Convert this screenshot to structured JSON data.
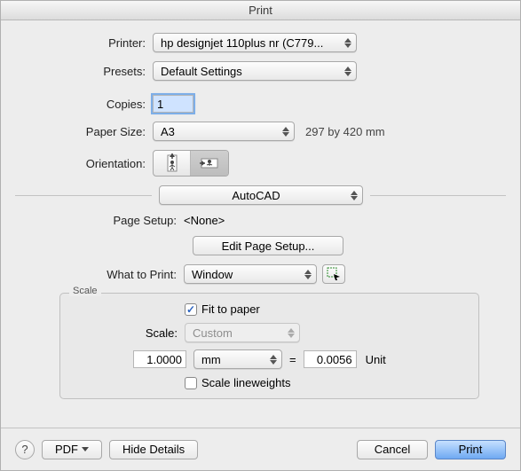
{
  "window": {
    "title": "Print"
  },
  "header": {
    "printer_label": "Printer:",
    "printer_value": "hp designjet 110plus nr (C779...",
    "presets_label": "Presets:",
    "presets_value": "Default Settings"
  },
  "copies": {
    "label": "Copies:",
    "value": "1"
  },
  "paper": {
    "label": "Paper Size:",
    "value": "A3",
    "dims": "297 by 420 mm"
  },
  "orientation": {
    "label": "Orientation:"
  },
  "section": {
    "module": "AutoCAD"
  },
  "page_setup": {
    "label": "Page Setup:",
    "value": "<None>",
    "edit_label": "Edit Page Setup..."
  },
  "what_to_print": {
    "label": "What to Print:",
    "value": "Window"
  },
  "scale": {
    "legend": "Scale",
    "fit_label": "Fit to paper",
    "fit_checked": true,
    "scale_label": "Scale:",
    "scale_value": "Custom",
    "left_value": "1.0000",
    "unit_value": "mm",
    "eq": "=",
    "right_value": "0.0056",
    "unit_text": "Unit",
    "lineweights_label": "Scale lineweights",
    "lineweights_checked": false
  },
  "footer": {
    "help": "?",
    "pdf": "PDF",
    "hide_details": "Hide Details",
    "cancel": "Cancel",
    "print": "Print"
  }
}
